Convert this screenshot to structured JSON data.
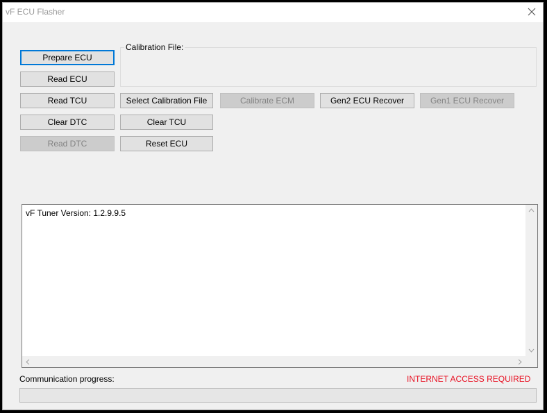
{
  "window": {
    "title": "vF ECU Flasher",
    "close_glyph": "✕"
  },
  "calibration": {
    "group_label": "Calibration File:"
  },
  "buttons": {
    "prepare_ecu": "Prepare ECU",
    "read_ecu": "Read ECU",
    "read_tcu": "Read TCU",
    "clear_dtc": "Clear DTC",
    "read_dtc": "Read DTC",
    "select_calibration_file": "Select Calibration File",
    "clear_tcu": "Clear TCU",
    "reset_ecu": "Reset ECU",
    "calibrate_ecm": "Calibrate ECM",
    "gen2_ecu_recover": "Gen2 ECU Recover",
    "gen1_ecu_recover": "Gen1 ECU Recover"
  },
  "log": {
    "text": "vF Tuner Version: 1.2.9.9.5"
  },
  "status": {
    "progress_label": "Communication progress:",
    "internet_notice": "INTERNET ACCESS REQUIRED",
    "progress_value": 0
  },
  "colors": {
    "accent": "#0078d7",
    "warning": "#e81123",
    "progress_fill": "#06b025"
  },
  "icons": {
    "close": "close-icon",
    "scroll_up": "chevron-up-icon",
    "scroll_down": "chevron-down-icon",
    "scroll_left": "chevron-left-icon",
    "scroll_right": "chevron-right-icon"
  }
}
